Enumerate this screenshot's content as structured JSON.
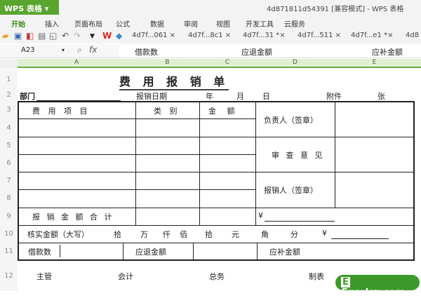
{
  "app": {
    "name": "WPS 表格",
    "title": "4d871811d54391 [兼容模式] - WPS 表格"
  },
  "menu": [
    "开始",
    "插入",
    "页面布局",
    "公式",
    "数据",
    "审阅",
    "视图",
    "开发工具",
    "云服务"
  ],
  "tabs": [
    "4d7f...061 ×",
    "4d7f...8c1 ×",
    "4d7f...31 *×",
    "4d7f...511 ×",
    "4d7f...e1 *×",
    "4d8"
  ],
  "formula": {
    "cell": "A23",
    "fx": "fx",
    "content": [
      "借款数",
      "应退金额",
      "应补金额"
    ]
  },
  "columns": [
    "A",
    "B",
    "C",
    "D",
    "E"
  ],
  "rows": [
    "1",
    "2",
    "3",
    "4",
    "5",
    "6",
    "7",
    "8",
    "9",
    "10",
    "11",
    "12"
  ],
  "sheet": {
    "title": "费 用 报 销 单",
    "dept": "部门",
    "date": "报销日期",
    "year": "年",
    "month": "月",
    "day": "日",
    "attach": "附件",
    "sheets": "张",
    "h_item": "费 用 项 目",
    "h_cat": "类 别",
    "h_amt": "金 额",
    "resp": "负责人（签章）",
    "review": "审 查 意 见",
    "claimant": "报销人（签章）",
    "total": "报 销 金 额 合 计",
    "yen1": "¥",
    "verify": "核实金额（大写）",
    "units": [
      "拾",
      "万",
      "仟",
      "佰",
      "拾",
      "元",
      "角",
      "分"
    ],
    "yen2": "¥",
    "loan": "借款数",
    "refund": "应退金额",
    "supplement": "应补金额",
    "sign": [
      "主管",
      "会计",
      "总务",
      "制表"
    ]
  },
  "watermark": "Excelcn.com"
}
